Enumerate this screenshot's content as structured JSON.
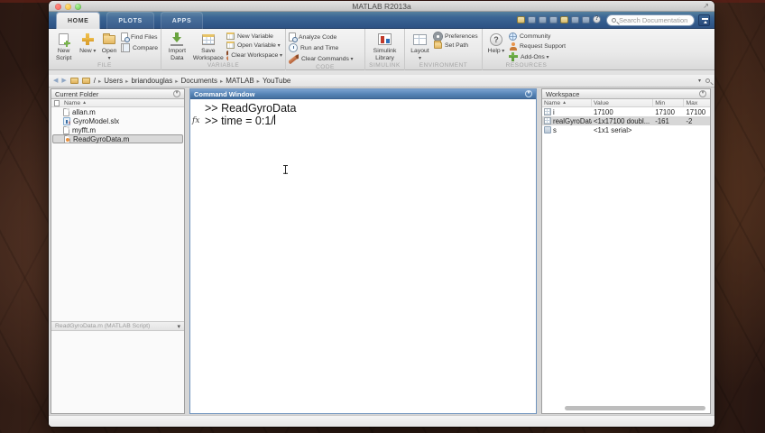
{
  "window": {
    "title": "MATLAB R2013a"
  },
  "tabs": [
    {
      "label": "HOME"
    },
    {
      "label": "PLOTS"
    },
    {
      "label": "APPS"
    }
  ],
  "quick_access": {
    "search_placeholder": "Search Documentation"
  },
  "ribbon": {
    "file_label": "FILE",
    "new_script": "New Script",
    "new": "New",
    "open": "Open",
    "find_files": "Find Files",
    "compare": "Compare",
    "variable_label": "VARIABLE",
    "import_data": "Import Data",
    "save_workspace": "Save Workspace",
    "new_variable": "New Variable",
    "open_variable": "Open Variable",
    "clear_workspace": "Clear Workspace",
    "code_label": "CODE",
    "analyze_code": "Analyze Code",
    "run_and_time": "Run and Time",
    "clear_commands": "Clear Commands",
    "simulink_label": "SIMULINK",
    "simulink_library": "Simulink Library",
    "environment_label": "ENVIRONMENT",
    "layout": "Layout",
    "preferences": "Preferences",
    "set_path": "Set Path",
    "resources_label": "RESOURCES",
    "help": "Help",
    "community": "Community",
    "request_support": "Request Support",
    "add_ons": "Add-Ons"
  },
  "breadcrumb": {
    "segments": [
      "/",
      "Users",
      "briandouglas",
      "Documents",
      "MATLAB",
      "YouTube"
    ]
  },
  "current_folder": {
    "title": "Current Folder",
    "name_column": "Name",
    "files": [
      {
        "name": "allan.m"
      },
      {
        "name": "GyroModel.slx"
      },
      {
        "name": "myfft.m"
      },
      {
        "name": "ReadGyroData.m"
      }
    ],
    "details_bar": "ReadGyroData.m (MATLAB Script)"
  },
  "command_window": {
    "title": "Command Window",
    "fx_label": "fx",
    "history_line": ">> ReadGyroData",
    "current_line": ">> time = 0:1/"
  },
  "workspace": {
    "title": "Workspace",
    "columns": [
      "Name",
      "Value",
      "Min",
      "Max"
    ],
    "rows": [
      {
        "name": "i",
        "value": "17100",
        "min": "17100",
        "max": "17100"
      },
      {
        "name": "realGyroData",
        "value": "<1x17100 doubl...",
        "min": "-161",
        "max": "-2"
      },
      {
        "name": "s",
        "value": "<1x1 serial>",
        "min": "",
        "max": ""
      }
    ]
  },
  "colors": {
    "tab_bar_blue": "#3b6594",
    "command_header_blue": "#5583b5",
    "ribbon_gray": "#ececec",
    "selection_gray": "#d9d9d9",
    "desktop_brown": "#43281c"
  }
}
